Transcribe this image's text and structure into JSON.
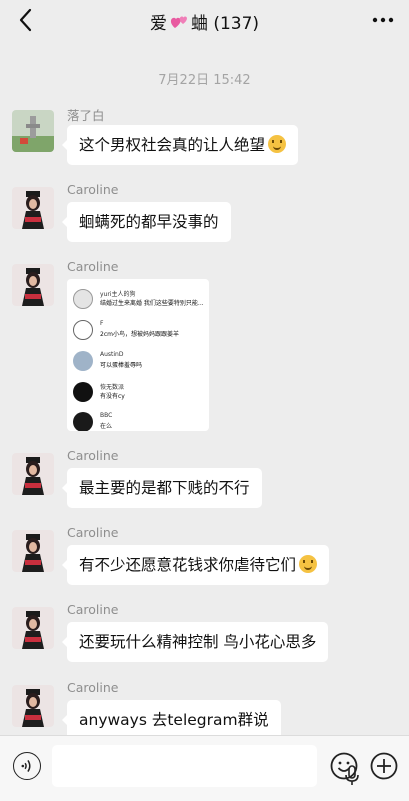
{
  "header": {
    "title_prefix": "爱",
    "title_suffix": "蛐 (137)",
    "back_icon": "chevron-left-icon",
    "more_icon": "more-dots-icon"
  },
  "timestamp": "7月22日 15:42",
  "messages": [
    {
      "sender": "落了白",
      "text": "这个男权社会真的让人绝望",
      "emoji": "weary-face"
    },
    {
      "sender": "Caroline",
      "text": "蛔螨死的都早没事的"
    },
    {
      "sender": "Caroline",
      "type": "image"
    },
    {
      "sender": "Caroline",
      "text": "最主要的是都下贱的不行"
    },
    {
      "sender": "Caroline",
      "text": "有不少还愿意花钱求你虐待它们",
      "emoji": "grinning-squinting-face"
    },
    {
      "sender": "Caroline",
      "text": "还要玩什么精神控制 鸟小花心思多"
    },
    {
      "sender": "Caroline",
      "text": "anyways 去telegram群说"
    }
  ],
  "screenshot_items": [
    {
      "name": "yuri主人的狗",
      "text": "结婚过生来离婚 我们这些要特别只能..."
    },
    {
      "name": "F",
      "text": "2cm小鸟，想被妈妈跟跟姜羊"
    },
    {
      "name": "AustinD",
      "text": "可以蛋棒羞辱吗"
    },
    {
      "name": "恢无数派",
      "text": "有没有cy"
    },
    {
      "name": "BBC",
      "text": "在么"
    }
  ],
  "bottom_bar": {
    "voice_icon": "voice-icon",
    "mic_icon": "microphone-icon",
    "emoji_icon": "emoji-icon",
    "plus_icon": "plus-icon"
  }
}
